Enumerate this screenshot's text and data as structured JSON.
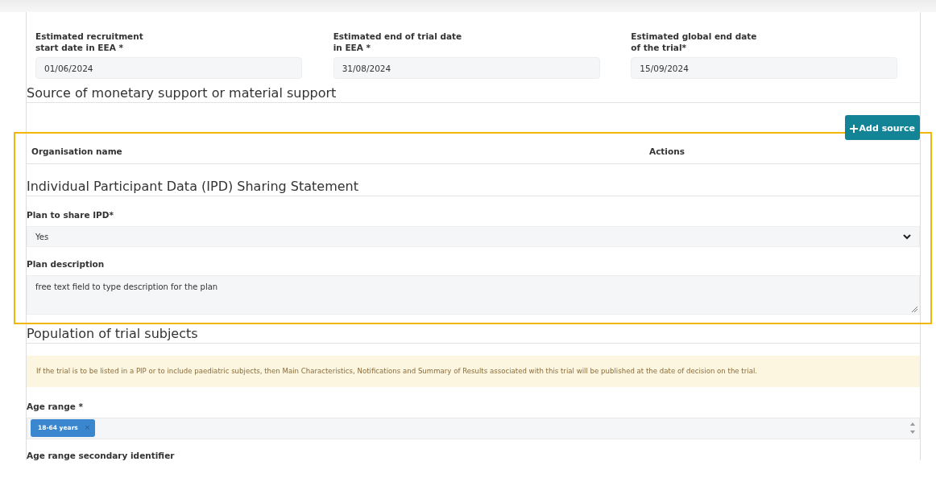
{
  "date_fields": [
    {
      "label": "Estimated recruitment\nstart date in EEA *",
      "value": "01/06/2024"
    },
    {
      "label": "Estimated end of trial date\nin EEA *",
      "value": "31/08/2024"
    },
    {
      "label": "Estimated global end date\nof the trial*",
      "value": "15/09/2024"
    }
  ],
  "support_section": {
    "heading": "Source of monetary support or material support",
    "add_button": "Add source",
    "table": {
      "columns": [
        "Organisation name",
        "Actions"
      ]
    }
  },
  "ipd_section": {
    "heading": "Individual Participant Data (IPD) Sharing Statement",
    "plan_label": "Plan to share IPD*",
    "plan_value": "Yes",
    "description_label": "Plan description",
    "description_value": "free text field to type description for the plan"
  },
  "population_section": {
    "heading": "Population of trial subjects",
    "notice": "If the trial is to be listed in a PIP or to include paediatric subjects, then Main Characteristics, Notifications and Summary of Results associated with this trial will be published at the date of decision on the trial.",
    "age_range_label": "Age range *",
    "age_range_tags": [
      {
        "label": "18-64 years",
        "remove": "×"
      }
    ],
    "secondary_label": "Age range secondary identifier"
  }
}
